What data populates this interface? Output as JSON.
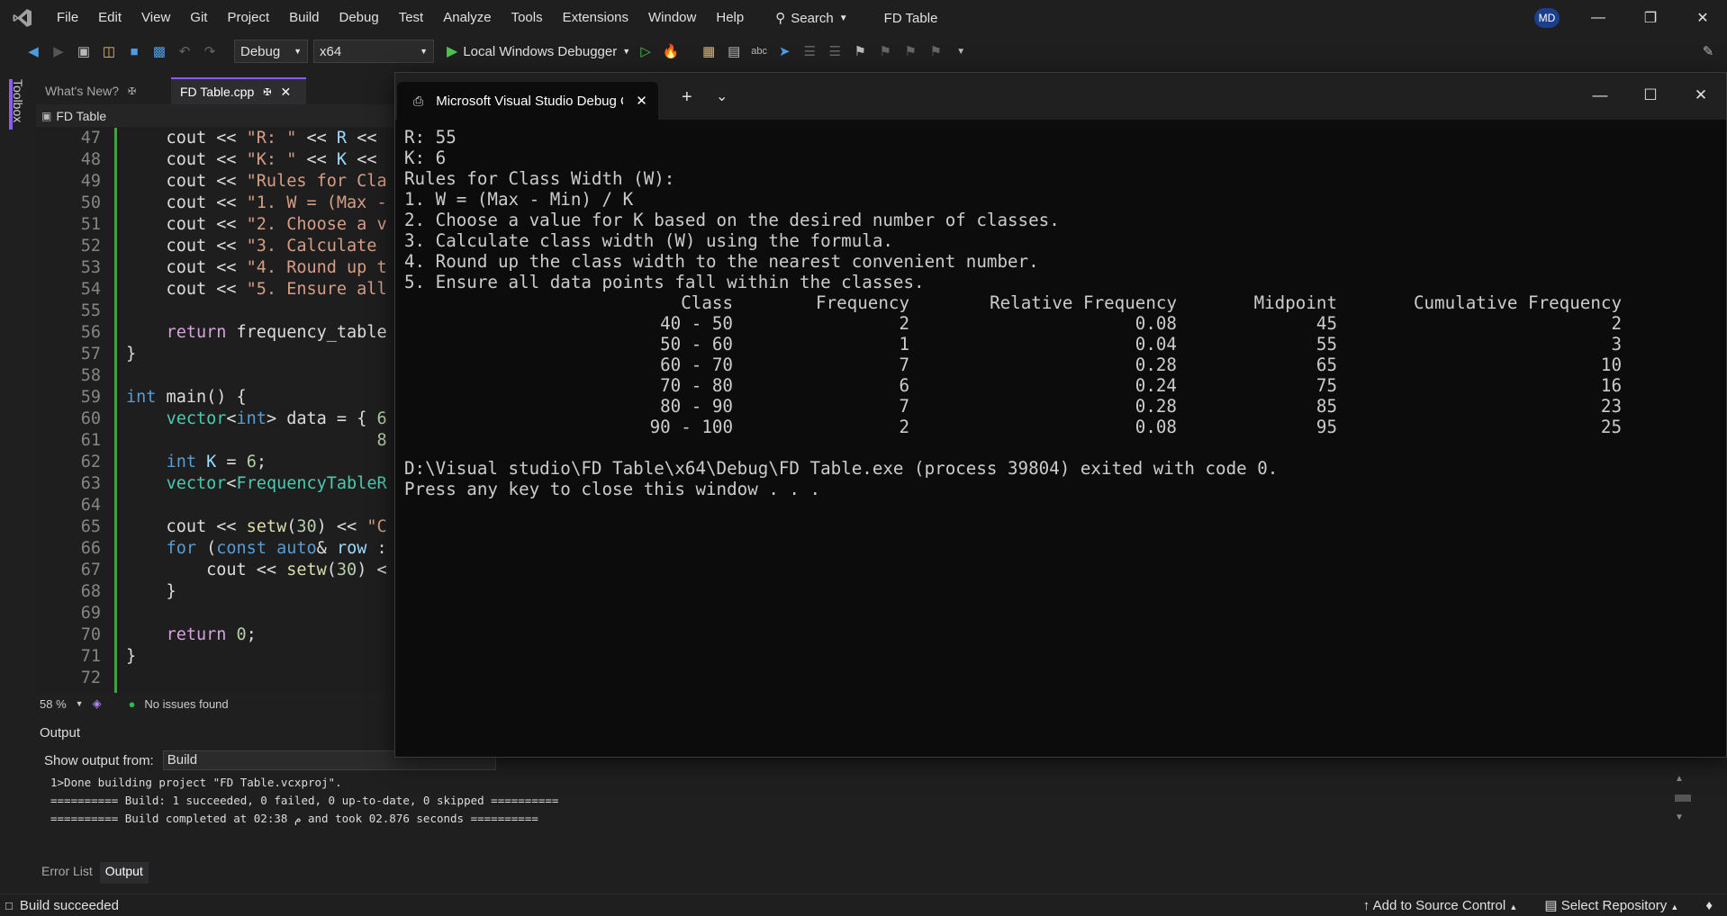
{
  "menubar": {
    "items": [
      "File",
      "Edit",
      "View",
      "Git",
      "Project",
      "Build",
      "Debug",
      "Test",
      "Analyze",
      "Tools",
      "Extensions",
      "Window",
      "Help"
    ],
    "search_label": "Search",
    "solution_name": "FD Table",
    "avatar_initials": "MD"
  },
  "toolbar": {
    "config": "Debug",
    "platform": "x64",
    "run_label": "Local Windows Debugger"
  },
  "toolbox_label": "Toolbox",
  "doc_tabs": [
    {
      "label": "What's New?"
    },
    {
      "label": "FD Table.cpp"
    }
  ],
  "nav_bar": {
    "project": "FD Table"
  },
  "editor": {
    "lines": [
      {
        "n": "47",
        "text": "    cout << \"R: \" << R <<"
      },
      {
        "n": "48",
        "text": "    cout << \"K: \" << K <<"
      },
      {
        "n": "49",
        "text": "    cout << \"Rules for Cla"
      },
      {
        "n": "50",
        "text": "    cout << \"1. W = (Max -"
      },
      {
        "n": "51",
        "text": "    cout << \"2. Choose a v"
      },
      {
        "n": "52",
        "text": "    cout << \"3. Calculate "
      },
      {
        "n": "53",
        "text": "    cout << \"4. Round up t"
      },
      {
        "n": "54",
        "text": "    cout << \"5. Ensure all"
      },
      {
        "n": "55",
        "text": ""
      },
      {
        "n": "56",
        "text": "    return frequency_table"
      },
      {
        "n": "57",
        "text": "}"
      },
      {
        "n": "58",
        "text": ""
      },
      {
        "n": "59",
        "text": "int main() {"
      },
      {
        "n": "60",
        "text": "    vector<int> data = { 6"
      },
      {
        "n": "61",
        "text": "                         8"
      },
      {
        "n": "62",
        "text": "    int K = 6;"
      },
      {
        "n": "63",
        "text": "    vector<FrequencyTableR"
      },
      {
        "n": "64",
        "text": ""
      },
      {
        "n": "65",
        "text": "    cout << setw(30) << \"C"
      },
      {
        "n": "66",
        "text": "    for (const auto& row :"
      },
      {
        "n": "67",
        "text": "        cout << setw(30) <"
      },
      {
        "n": "68",
        "text": "    }"
      },
      {
        "n": "69",
        "text": ""
      },
      {
        "n": "70",
        "text": "    return 0;"
      },
      {
        "n": "71",
        "text": "}"
      },
      {
        "n": "72",
        "text": ""
      }
    ],
    "zoom": "58 %",
    "issues": "No issues found"
  },
  "output": {
    "title": "Output",
    "show_from_label": "Show output from:",
    "source": "Build",
    "lines": [
      "1>Done building project \"FD Table.vcxproj\".",
      "========== Build: 1 succeeded, 0 failed, 0 up-to-date, 0 skipped ==========",
      "========== Build completed at 02:38 م and took 02.876 seconds =========="
    ]
  },
  "bottom_tabs": [
    "Error List",
    "Output"
  ],
  "statusbar": {
    "left": "Build succeeded",
    "source_control": "Add to Source Control",
    "repo": "Select Repository"
  },
  "console": {
    "tab_title": "Microsoft Visual Studio Debug Console",
    "pre_lines": [
      "R: 55",
      "K: 6",
      "Rules for Class Width (W):",
      "1. W = (Max - Min) / K",
      "2. Choose a value for K based on the desired number of classes.",
      "3. Calculate class width (W) using the formula.",
      "4. Round up the class width to the nearest convenient number.",
      "5. Ensure all data points fall within the classes."
    ],
    "table": {
      "headers": [
        "Class",
        "Frequency",
        "Relative Frequency",
        "Midpoint",
        "Cumulative Frequency"
      ],
      "rows": [
        [
          "40 - 50",
          "2",
          "0.08",
          "45",
          "2"
        ],
        [
          "50 - 60",
          "1",
          "0.04",
          "55",
          "3"
        ],
        [
          "60 - 70",
          "7",
          "0.28",
          "65",
          "10"
        ],
        [
          "70 - 80",
          "6",
          "0.24",
          "75",
          "16"
        ],
        [
          "80 - 90",
          "7",
          "0.28",
          "85",
          "23"
        ],
        [
          "90 - 100",
          "2",
          "0.08",
          "95",
          "25"
        ]
      ]
    },
    "post_lines": [
      "D:\\Visual studio\\FD Table\\x64\\Debug\\FD Table.exe (process 39804) exited with code 0.",
      "Press any key to close this window . . ."
    ]
  }
}
